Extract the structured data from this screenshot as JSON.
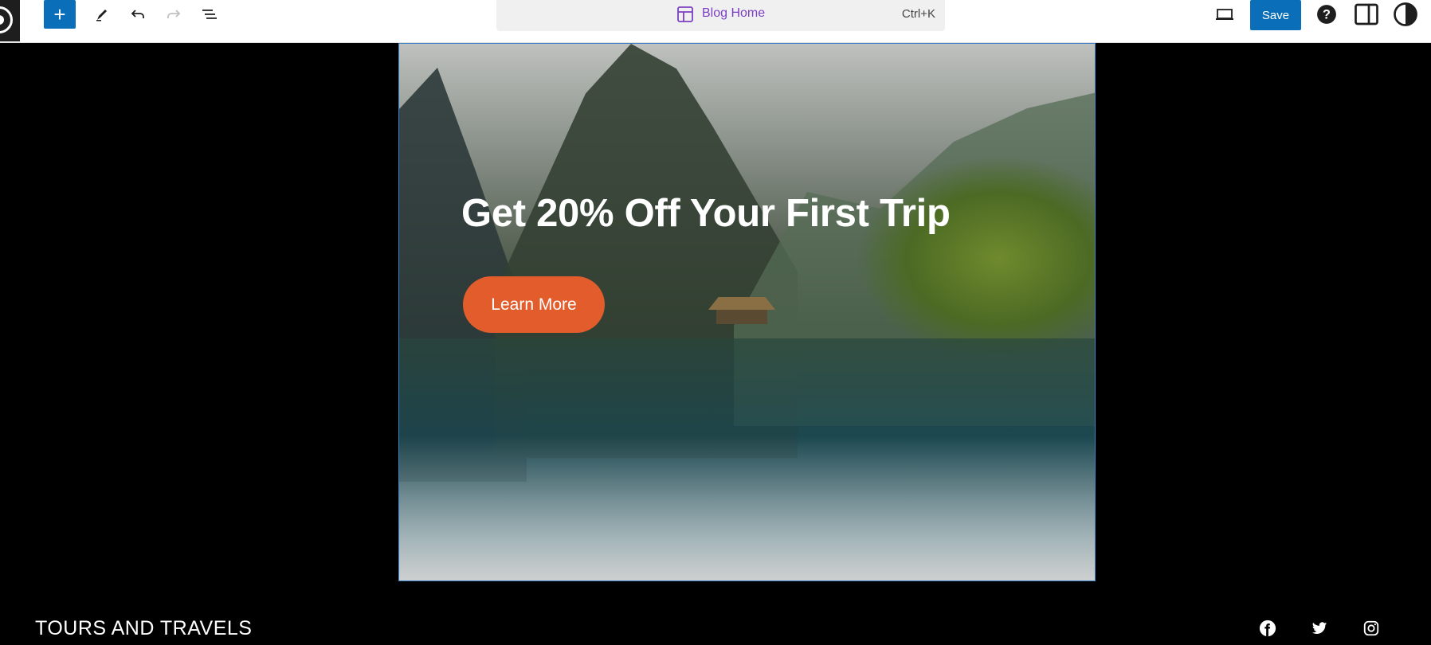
{
  "toolbar": {
    "add_label": "+",
    "template_title": "Blog Home",
    "shortcut": "Ctrl+K",
    "save_label": "Save"
  },
  "hero": {
    "title": "Get 20% Off Your First Trip",
    "button_label": "Learn More"
  },
  "footer": {
    "site_title": "TOURS AND TRAVELS"
  },
  "colors": {
    "accent": "#0a6fb8",
    "template_purple": "#7b3fc1",
    "cta_orange": "#e25c2c"
  },
  "icons": [
    "wordpress-logo-icon",
    "plus-icon",
    "pencil-icon",
    "undo-icon",
    "redo-icon",
    "list-view-icon",
    "template-icon",
    "desktop-preview-icon",
    "help-icon",
    "sidebar-icon",
    "styles-icon",
    "facebook-icon",
    "twitter-icon",
    "instagram-icon"
  ]
}
